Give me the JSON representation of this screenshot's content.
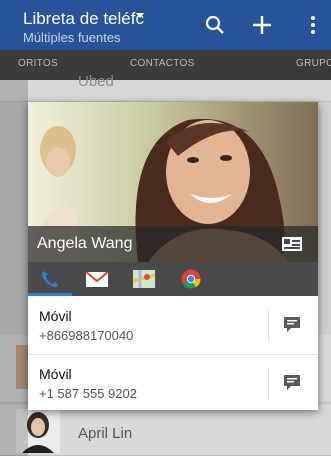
{
  "app_bar": {
    "title": "Libreta de teléfc",
    "subtitle": "Múltiples fuentes",
    "color": "#27539a"
  },
  "tabs": [
    {
      "label": "ORITOS"
    },
    {
      "label": "CONTACTOS"
    },
    {
      "label": "GRUPO"
    }
  ],
  "background_list": [
    {
      "name": "Ubed"
    },
    {
      "name": "April Lin"
    }
  ],
  "contact_card": {
    "name": "Angela Wang",
    "actions": [
      "phone-icon",
      "email-icon",
      "maps-icon",
      "chrome-icon"
    ],
    "phones": [
      {
        "label": "Móvil",
        "number": "+866988170040"
      },
      {
        "label": "Móvil",
        "number": "+1 587 555 9202"
      }
    ],
    "accent": "#2f7fd6"
  }
}
